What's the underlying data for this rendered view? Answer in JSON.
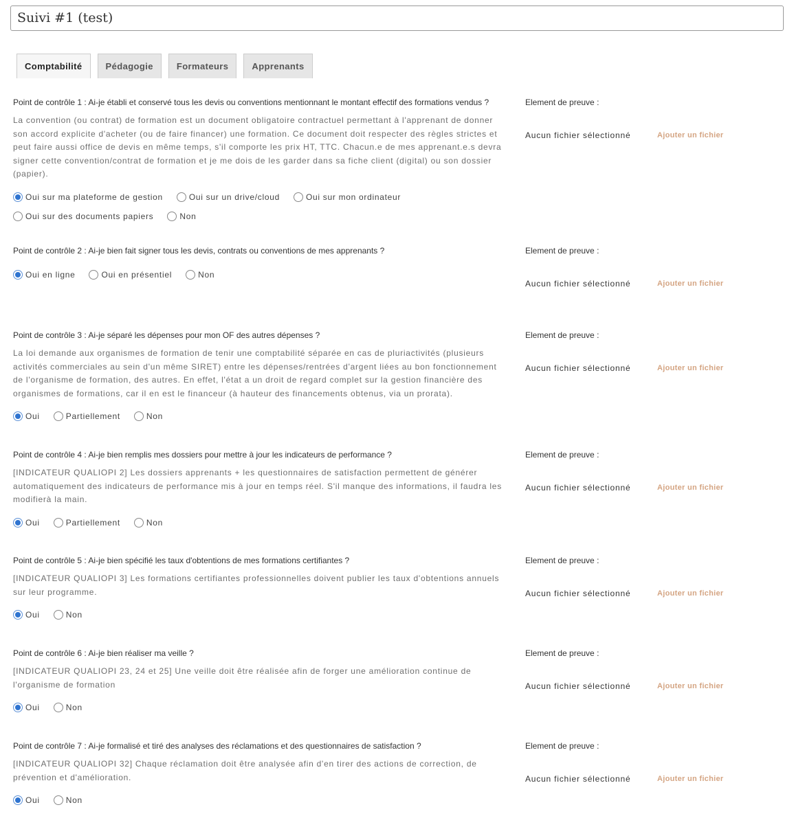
{
  "title": "Suivi #1 (test)",
  "tabs": [
    {
      "label": "Comptabilité",
      "active": true
    },
    {
      "label": "Pédagogie"
    },
    {
      "label": "Formateurs"
    },
    {
      "label": "Apprenants"
    }
  ],
  "proof_label": "Element de preuve :",
  "no_file": "Aucun fichier sélectionné",
  "add_file": "Ajouter un fichier",
  "accent": "#2f74d0",
  "items": [
    {
      "question": "Point de contrôle 1 : Ai-je établi et conservé tous les devis ou conventions mentionnant le montant effectif des formations vendus ?",
      "description": "La convention (ou contrat) de formation est un document obligatoire contractuel permettant à l'apprenant de donner son accord explicite d'acheter (ou de faire financer) une formation. Ce document doit respecter des règles strictes et peut faire aussi office de devis en même temps, s'il comporte les prix HT, TTC. Chacun.e de mes apprenant.e.s devra signer cette convention/contrat de formation et je me dois de les garder dans sa fiche client (digital) ou son dossier (papier).",
      "options": [
        "Oui sur ma plateforme de gestion",
        "Oui sur un drive/cloud",
        "Oui sur mon ordinateur",
        "Oui sur des documents papiers",
        "Non"
      ],
      "selected": 0
    },
    {
      "question": "Point de contrôle 2 : Ai-je bien fait signer tous les devis, contrats ou conventions de mes apprenants ?",
      "description": "",
      "options": [
        "Oui en ligne",
        "Oui en présentiel",
        "Non"
      ],
      "selected": 0
    },
    {
      "question": "Point de contrôle 3 : Ai-je séparé les dépenses pour mon OF des autres dépenses ?",
      "description": "La loi demande aux organismes de formation de tenir une comptabilité séparée en cas de pluriactivités (plusieurs activités commerciales au sein d'un même SIRET) entre les dépenses/rentrées d'argent liées au bon fonctionnement de l'organisme de formation, des autres. En effet, l'état a un droit de regard complet sur la gestion financière des organismes de formations, car il en est le financeur (à hauteur des financements obtenus, via un prorata).",
      "options": [
        "Oui",
        "Partiellement",
        "Non"
      ],
      "selected": 0
    },
    {
      "question": "Point de contrôle 4 : Ai-je bien remplis mes dossiers pour mettre à jour les indicateurs de performance ?",
      "description": "[INDICATEUR QUALIOPI 2] Les dossiers apprenants + les questionnaires de satisfaction permettent de générer automatiquement des indicateurs de performance mis à jour en temps réel. S'il manque des informations, il faudra les modifierà la main.",
      "options": [
        "Oui",
        "Partiellement",
        "Non"
      ],
      "selected": 0
    },
    {
      "question": "Point de contrôle 5 : Ai-je bien spécifié les taux d'obtentions de mes formations certifiantes ?",
      "description": "[INDICATEUR QUALIOPI 3] Les formations certifiantes professionnelles doivent publier les taux d'obtentions annuels sur leur programme.",
      "options": [
        "Oui",
        "Non"
      ],
      "selected": 0
    },
    {
      "question": "Point de contrôle 6 : Ai-je bien réaliser ma veille ?",
      "description": "[INDICATEUR QUALIOPI 23, 24 et 25] Une veille doit être réalisée afin de forger une amélioration continue de l'organisme de formation",
      "options": [
        "Oui",
        "Non"
      ],
      "selected": 0
    },
    {
      "question": "Point de contrôle 7 : Ai-je formalisé et tiré des analyses des réclamations et des questionnaires de satisfaction ?",
      "description": "[INDICATEUR QUALIOPI 32] Chaque réclamation doit être analysée afin d'en tirer des actions de correction, de prévention et d'amélioration.",
      "options": [
        "Oui",
        "Non"
      ],
      "selected": 0
    }
  ]
}
